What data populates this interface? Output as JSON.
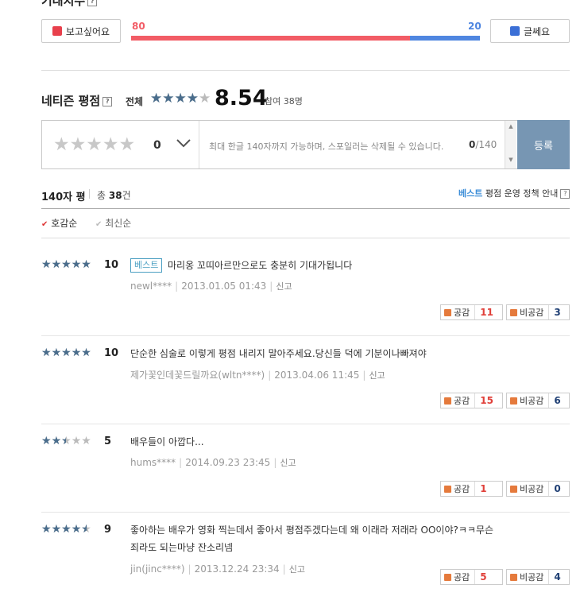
{
  "expect": {
    "title": "기대지수",
    "want_label": "보고싶어요",
    "meh_label": "글쎄요",
    "want_value": 80,
    "meh_value": 20,
    "want_color": "#f25c66",
    "meh_color": "#4f86e0"
  },
  "netizen": {
    "title": "네티즌 평점",
    "all_label": "전체",
    "stars_filled": 4,
    "stars_total": 5,
    "score": "8.54",
    "participants": "참여 38명",
    "input_stars": 5,
    "input_score": "0",
    "placeholder": "최대 한글 140자까지 가능하며, 스포일러는 삭제될 수 있습니다.",
    "char_count": "0",
    "char_max": "/140",
    "submit_label": "등록"
  },
  "list_header": {
    "label": "140자 평",
    "total_prefix": "총 ",
    "total_count": "38",
    "total_suffix": "건",
    "policy_best": "베스트",
    "policy_rest": " 평점 운영 정책 안내",
    "sort_likes": "호감순",
    "sort_recent": "최신순"
  },
  "reviews": [
    {
      "stars": 5,
      "score": "10",
      "best": "베스트",
      "text": "마리옹 꼬띠아르만으로도 충분히 기대가됩니다",
      "text2": "",
      "user": "newl****",
      "date": "2013.01.05 01:43",
      "report": "신고",
      "like_label": "공감",
      "likes": "11",
      "dislike_label": "비공감",
      "dislikes": "3"
    },
    {
      "stars": 5,
      "score": "10",
      "best": "",
      "text": "단순한 심술로 이렇게 평점 내리지 말아주세요.당신들 덕에 기분이나빠져야",
      "text2": "",
      "user": "제가꽃인데꽃드릴까요(wltn****)",
      "date": "2013.04.06 11:45",
      "report": "신고",
      "like_label": "공감",
      "likes": "15",
      "dislike_label": "비공감",
      "dislikes": "6"
    },
    {
      "stars": 2.5,
      "score": "5",
      "best": "",
      "text": "배우들이 아깝다...",
      "text2": "",
      "user": "hums****",
      "date": "2014.09.23 23:45",
      "report": "신고",
      "like_label": "공감",
      "likes": "1",
      "dislike_label": "비공감",
      "dislikes": "0"
    },
    {
      "stars": 4.5,
      "score": "9",
      "best": "",
      "text": "좋아하는 배우가 영화 찍는데서 좋아서 평점주겠다는데 왜 이래라 저래라 OO이야?ㅋㅋ무슨",
      "text2": "죄라도 되는마냥 잔소리넴",
      "user": "jin(jinc****)",
      "date": "2013.12.24 23:34",
      "report": "신고",
      "like_label": "공감",
      "likes": "5",
      "dislike_label": "비공감",
      "dislikes": "4"
    }
  ]
}
